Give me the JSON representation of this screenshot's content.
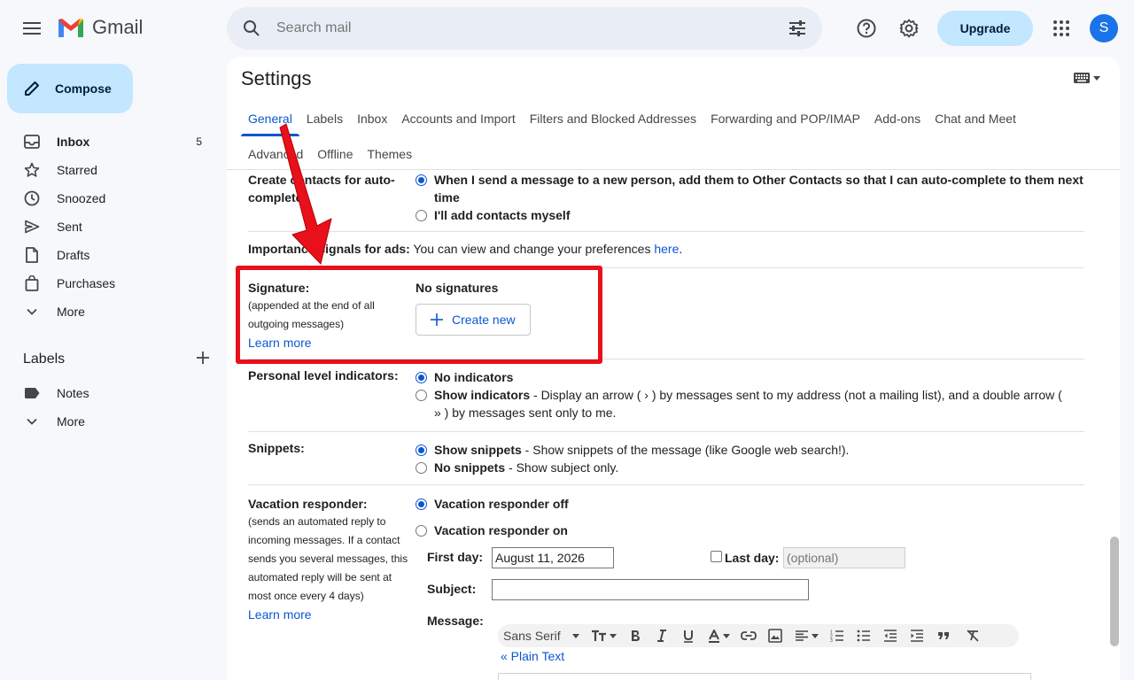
{
  "app": {
    "name": "Gmail",
    "colors": {
      "accent": "#0b57d0",
      "compose_bg": "#c2e7ff",
      "highlight": "#e8101a"
    }
  },
  "search": {
    "placeholder": "Search mail"
  },
  "header": {
    "upgrade_label": "Upgrade",
    "avatar_letter": "S"
  },
  "sidebar": {
    "compose_label": "Compose",
    "items": [
      {
        "label": "Inbox",
        "count": "5",
        "icon": "inbox-icon"
      },
      {
        "label": "Starred",
        "icon": "star-icon"
      },
      {
        "label": "Snoozed",
        "icon": "clock-icon"
      },
      {
        "label": "Sent",
        "icon": "send-icon"
      },
      {
        "label": "Drafts",
        "icon": "draft-icon"
      },
      {
        "label": "Purchases",
        "icon": "shopping-bag-icon"
      },
      {
        "label": "More",
        "icon": "chevron-down-icon"
      }
    ],
    "labels_title": "Labels",
    "labels": [
      {
        "label": "Notes",
        "icon": "label-icon"
      },
      {
        "label": "More",
        "icon": "chevron-down-icon"
      }
    ]
  },
  "settings": {
    "title": "Settings",
    "tabs_row1": [
      "General",
      "Labels",
      "Inbox",
      "Accounts and Import",
      "Filters and Blocked Addresses",
      "Forwarding and POP/IMAP",
      "Add-ons",
      "Chat and Meet"
    ],
    "tabs_row2": [
      "Advanced",
      "Offline",
      "Themes"
    ],
    "active_tab": "General",
    "create_contacts": {
      "label": "Create contacts for auto-complete:",
      "opt1": "When I send a message to a new person, add them to Other Contacts so that I can auto-complete to them next time",
      "opt2": "I'll add contacts myself"
    },
    "ads": {
      "label": "Importance signals for ads:",
      "text": "You can view and change your preferences",
      "link": "here",
      "period": "."
    },
    "signature": {
      "label": "Signature:",
      "sub": "(appended at the end of all outgoing messages)",
      "learn_more": "Learn more",
      "status": "No signatures",
      "create_new": "Create new"
    },
    "personal_level": {
      "label": "Personal level indicators:",
      "opt1": "No indicators",
      "opt2_bold": "Show indicators",
      "opt2_text": " - Display an arrow ( › ) by messages sent to my address (not a mailing list), and a double arrow ( » ) by messages sent only to me."
    },
    "snippets": {
      "label": "Snippets:",
      "opt1_bold": "Show snippets",
      "opt1_text": " - Show snippets of the message (like Google web search!).",
      "opt2_bold": "No snippets",
      "opt2_text": " - Show subject only."
    },
    "vacation": {
      "label": "Vacation responder:",
      "sub": "(sends an automated reply to incoming messages. If a contact sends you several messages, this automated reply will be sent at most once every 4 days)",
      "learn_more": "Learn more",
      "opt_off": "Vacation responder off",
      "opt_on": "Vacation responder on",
      "first_day_label": "First day:",
      "first_day_value": "August 11, 2026",
      "last_day_label": "Last day:",
      "last_day_placeholder": "(optional)",
      "subject_label": "Subject:",
      "message_label": "Message:",
      "font_name": "Sans Serif",
      "plain_text": "« Plain Text"
    }
  }
}
